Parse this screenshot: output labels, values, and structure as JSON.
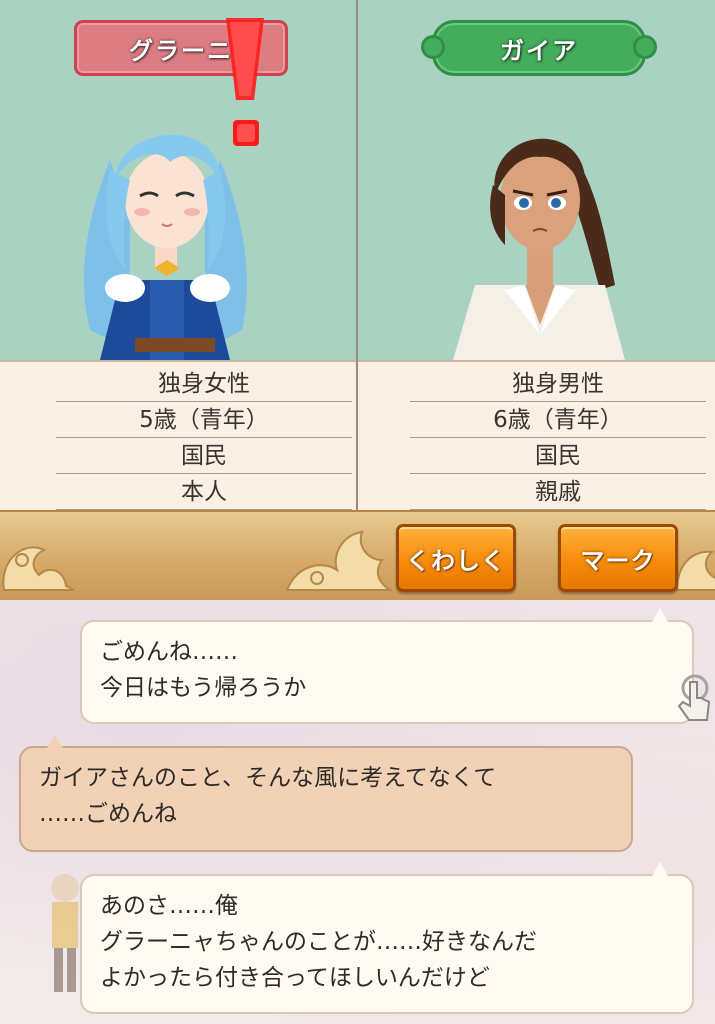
{
  "characters": {
    "left": {
      "name": "グラーニ",
      "reaction_icon": "exclamation-icon",
      "info": [
        "独身女性",
        "5歳（青年）",
        "国民",
        "本人"
      ],
      "plate_color": "#dc7d84"
    },
    "right": {
      "name": "ガイア",
      "info": [
        "独身男性",
        "6歳（青年）",
        "国民",
        "親戚"
      ],
      "plate_color": "#43ad5b"
    }
  },
  "buttons": {
    "details_label": "くわしく",
    "mark_label": "マーク",
    "color": "#f68c0c"
  },
  "dialogue": [
    {
      "side": "right",
      "lines": [
        "ごめんね……",
        "今日はもう帰ろうか"
      ]
    },
    {
      "side": "left",
      "lines": [
        "ガイアさんのこと、そんな風に考えてなくて",
        "……ごめんね"
      ]
    },
    {
      "side": "right",
      "lines": [
        "あのさ……俺",
        "グラーニャちゃんのことが……好きなんだ",
        "よかったら付き合ってほしいんだけど"
      ]
    }
  ],
  "colors": {
    "portrait_bg": "#a9d2c3",
    "info_bg": "#faf0e4",
    "button_bar": "#d4a866"
  }
}
